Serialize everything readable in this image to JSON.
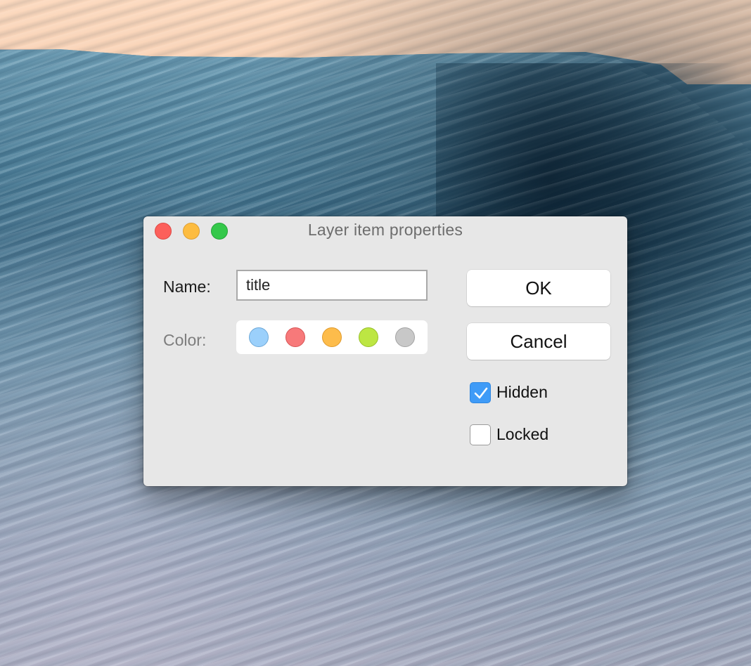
{
  "window": {
    "title": "Layer item properties"
  },
  "form": {
    "name_label": "Name:",
    "name_value": "title",
    "color_label": "Color:",
    "colors": [
      {
        "name": "blue-swatch",
        "fill": "#9bd0fb",
        "stroke": "#6ea9d8"
      },
      {
        "name": "red-swatch",
        "fill": "#f7797a",
        "stroke": "#d75455"
      },
      {
        "name": "orange-swatch",
        "fill": "#fdbc4b",
        "stroke": "#e09a2c"
      },
      {
        "name": "green-swatch",
        "fill": "#bde643",
        "stroke": "#98c02a"
      },
      {
        "name": "gray-swatch",
        "fill": "#c8c8c8",
        "stroke": "#a3a3a3"
      }
    ]
  },
  "buttons": {
    "ok": "OK",
    "cancel": "Cancel"
  },
  "options": {
    "hidden_label": "Hidden",
    "hidden_checked": true,
    "locked_label": "Locked",
    "locked_checked": false
  }
}
